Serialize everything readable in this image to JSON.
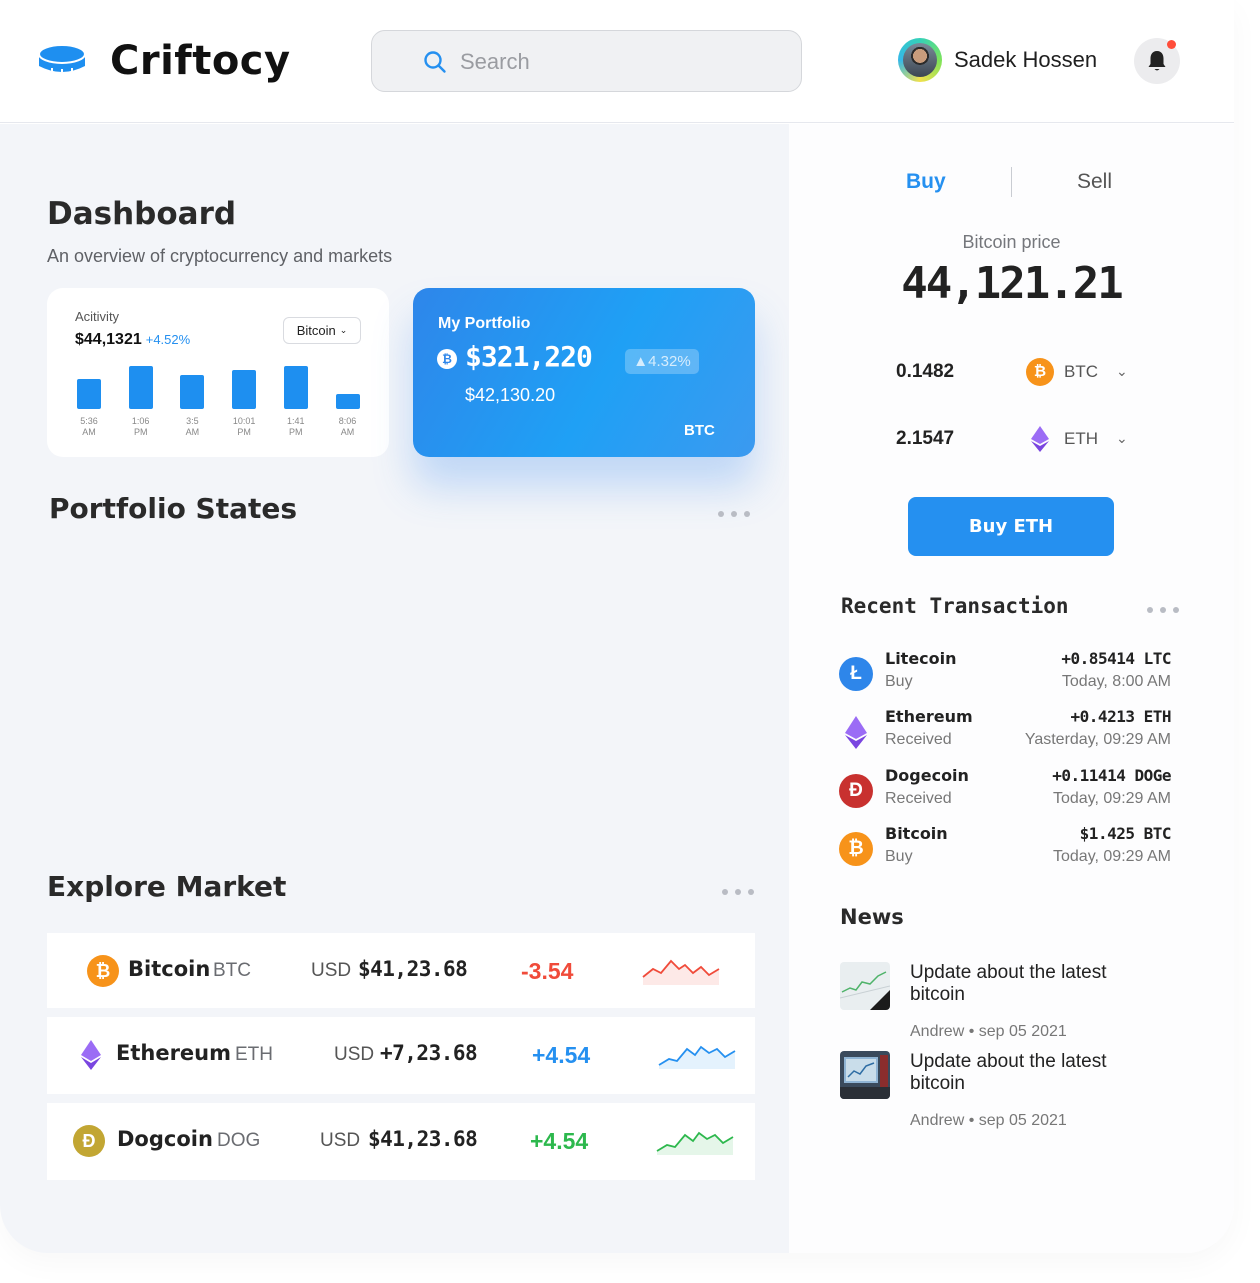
{
  "app": {
    "name": "Criftocy"
  },
  "search": {
    "placeholder": "Search"
  },
  "user": {
    "name": "Sadek Hossen"
  },
  "dashboard": {
    "title": "Dashboard",
    "subtitle": "An overview of cryptocurrency and markets"
  },
  "activity": {
    "label": "Acitivity",
    "value": "$44,1321",
    "change": "+4.52%",
    "select": "Bitcoin",
    "bars": [
      {
        "time": "5:36",
        "period": "AM",
        "level": 0.7
      },
      {
        "time": "1:06",
        "period": "PM",
        "level": 1.0
      },
      {
        "time": "3:5",
        "period": "AM",
        "level": 0.8
      },
      {
        "time": "10:01",
        "period": "PM",
        "level": 0.9
      },
      {
        "time": "1:41",
        "period": "PM",
        "level": 1.0
      },
      {
        "time": "8:06",
        "period": "AM",
        "level": 0.35
      }
    ]
  },
  "portfolio": {
    "title": "My Portfolio",
    "amount": "$321,220",
    "badge": "▲4.32%",
    "sub": "$42,130.20",
    "code": "BTC"
  },
  "portfolio_states": {
    "title": "Portfolio States"
  },
  "market": {
    "title": "Explore Market",
    "rows": [
      {
        "name": "Bitcoin",
        "symbol": "BTC",
        "currency": "USD",
        "price": "$41,23.68",
        "change": "-3.54",
        "trend": "down",
        "color": "#f04b3a",
        "icon_color": "#f7931a",
        "icon_glyph": "₿"
      },
      {
        "name": "Ethereum",
        "symbol": "ETH",
        "currency": "USD",
        "price": "+7,23.68",
        "change": "+4.54",
        "trend": "up",
        "color": "#2590f0",
        "icon_color": "#8c5cf0",
        "icon_glyph": "◆"
      },
      {
        "name": "Dogcoin",
        "symbol": "DOG",
        "currency": "USD",
        "price": "$41,23.68",
        "change": "+4.54",
        "trend": "up",
        "color": "#2db84d",
        "icon_color": "#c2a633",
        "icon_glyph": "Ð"
      }
    ]
  },
  "trade": {
    "tab_buy": "Buy",
    "tab_sell": "Sell",
    "price_label": "Bitcoin price",
    "price_value": "44,121.21",
    "conversions": [
      {
        "amount": "0.1482",
        "symbol": "BTC",
        "icon_color": "#f7931a",
        "icon_glyph": "₿"
      },
      {
        "amount": "2.1547",
        "symbol": "ETH",
        "icon_color": "#8c5cf0",
        "icon_glyph": "◆"
      }
    ],
    "button": "Buy ETH"
  },
  "recent": {
    "title": "Recent Transaction",
    "items": [
      {
        "name": "Litecoin",
        "type": "Buy",
        "amount": "+0.85414 LTC",
        "time": "Today, 8:00 AM",
        "icon_color": "#2e86ea",
        "icon_glyph": "Ł"
      },
      {
        "name": "Ethereum",
        "type": "Received",
        "amount": "+0.4213 ETH",
        "time": "Yasterday, 09:29 AM",
        "icon_color": "#8c5cf0",
        "icon_glyph": "◆"
      },
      {
        "name": "Dogecoin",
        "type": "Received",
        "amount": "+0.11414 DOGe",
        "time": "Today, 09:29 AM",
        "icon_color": "#c8312f",
        "icon_glyph": "Ð"
      },
      {
        "name": "Bitcoin",
        "type": "Buy",
        "amount": "$1.425 BTC",
        "time": "Today, 09:29 AM",
        "icon_color": "#f7931a",
        "icon_glyph": "₿"
      }
    ]
  },
  "news": {
    "title": "News",
    "items": [
      {
        "headline": "Update about the latest bitcoin",
        "author": "Andrew",
        "date": "sep 05 2021"
      },
      {
        "headline": "Update about the latest bitcoin",
        "author": "Andrew",
        "date": "sep 05 2021"
      }
    ]
  }
}
